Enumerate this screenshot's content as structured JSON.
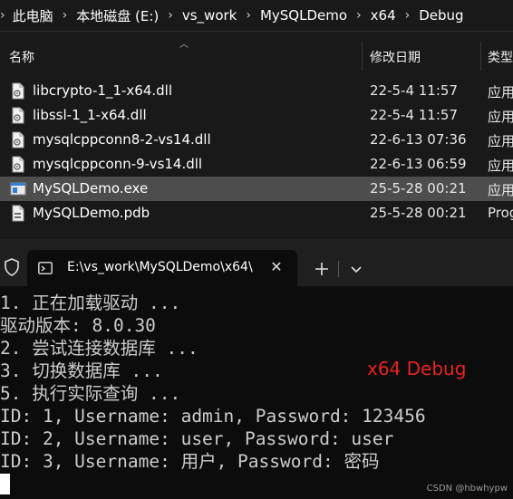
{
  "explorer": {
    "breadcrumb": [
      "此电脑",
      "本地磁盘 (E:)",
      "vs_work",
      "MySQLDemo",
      "x64",
      "Debug"
    ],
    "columns": {
      "name": "名称",
      "date": "修改日期",
      "type": "类型"
    },
    "files": [
      {
        "name": "libcrypto-1_1-x64.dll",
        "date": "22-5-4 11:57",
        "type": "应用",
        "icon": "dll-icon",
        "selected": false
      },
      {
        "name": "libssl-1_1-x64.dll",
        "date": "22-5-4 11:57",
        "type": "应用",
        "icon": "dll-icon",
        "selected": false
      },
      {
        "name": "mysqlcppconn8-2-vs14.dll",
        "date": "22-6-13 07:36",
        "type": "应用",
        "icon": "dll-icon",
        "selected": false
      },
      {
        "name": "mysqlcppconn-9-vs14.dll",
        "date": "22-6-13 06:59",
        "type": "应用",
        "icon": "dll-icon",
        "selected": false
      },
      {
        "name": "MySQLDemo.exe",
        "date": "25-5-28 00:21",
        "type": "应用",
        "icon": "exe-icon",
        "selected": true
      },
      {
        "name": "MySQLDemo.pdb",
        "date": "25-5-28 00:21",
        "type": "Prog",
        "icon": "pdb-icon",
        "selected": false
      }
    ]
  },
  "terminal": {
    "tab_title": "E:\\vs_work\\MySQLDemo\\x64\\",
    "lines": [
      "1. 正在加载驱动 ...",
      "驱动版本: 8.0.30",
      "2. 尝试连接数据库 ...",
      "3. 切换数据库 ...",
      "5. 执行实际查询 ...",
      "ID: 1, Username: admin, Password: 123456",
      "ID: 2, Username: user, Password: user",
      "ID: 3, Username: 用户, Password: 密码"
    ],
    "annotation": "x64 Debug"
  },
  "watermark": "CSDN @hbwhypw",
  "colors": {
    "annotation": "#e8231f",
    "selected_row": "#4d4d4d",
    "terminal_bg": "#0c0c0c"
  }
}
